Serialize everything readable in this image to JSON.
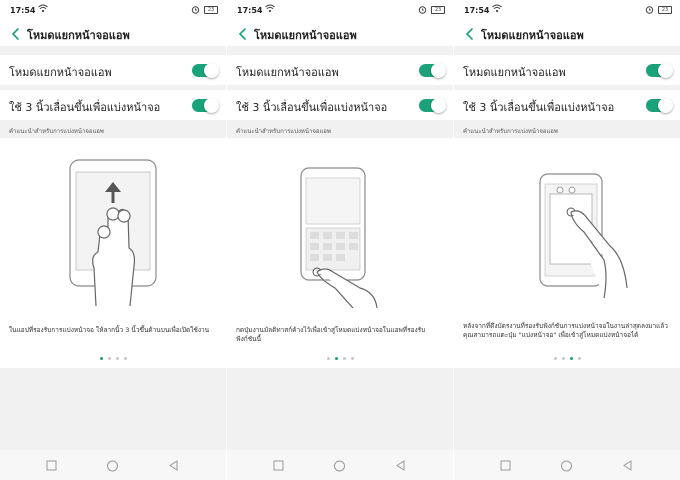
{
  "accent_color": "#1aa37a",
  "panels": [
    {
      "status": {
        "time": "17:54",
        "battery": "23"
      },
      "header": {
        "title": "โหมดแยกหน้าจอแอพ"
      },
      "settings": [
        {
          "label": "โหมดแยกหน้าจอแอพ",
          "toggle_on": true
        },
        {
          "label": "ใช้ 3 นิ้วเลื่อนขึ้นเพื่อแบ่งหน้าจอ",
          "toggle_on": true
        }
      ],
      "section_label": "คำแนะนำสำหรับการแบ่งหน้าจอแอพ",
      "description": "ในแอปที่รองรับการแบ่งหน้าจอ ให้ลากนิ้ว 3 นิ้วขึ้นด้านบนเพื่อเปิดใช้งาน",
      "illustration_icon": "three-finger-swipe-up-icon",
      "page_dots": {
        "count": 4,
        "active": 0
      }
    },
    {
      "status": {
        "time": "17:54",
        "battery": "23"
      },
      "header": {
        "title": "โหมดแยกหน้าจอแอพ"
      },
      "settings": [
        {
          "label": "โหมดแยกหน้าจอแอพ",
          "toggle_on": true
        },
        {
          "label": "ใช้ 3 นิ้วเลื่อนขึ้นเพื่อแบ่งหน้าจอ",
          "toggle_on": true
        }
      ],
      "section_label": "คำแนะนำสำหรับการแบ่งหน้าจอแอพ",
      "description": "กดปุ่มงานมัลติทาสก์ค้างไว้เพื่อเข้าสู่โหมดแบ่งหน้าจอในแอพที่รองรับฟังก์ชันนี้",
      "illustration_icon": "multitask-long-press-icon",
      "page_dots": {
        "count": 4,
        "active": 1
      }
    },
    {
      "status": {
        "time": "17:54",
        "battery": "23"
      },
      "header": {
        "title": "โหมดแยกหน้าจอแอพ"
      },
      "settings": [
        {
          "label": "โหมดแยกหน้าจอแอพ",
          "toggle_on": true
        },
        {
          "label": "ใช้ 3 นิ้วเลื่อนขึ้นเพื่อแบ่งหน้าจอ",
          "toggle_on": true
        }
      ],
      "section_label": "คำแนะนำสำหรับการแบ่งหน้าจอแอพ",
      "description": "หลังจากที่ดึงบัตรงานที่รองรับฟังก์ชันการแบ่งหน้าจอในงานล่าสุดลงมาแล้ว คุณสามารถแตะปุ่ม \"แบ่งหน้าจอ\" เพื่อเข้าสู่โหมดแบ่งหน้าจอได้",
      "illustration_icon": "recent-card-split-icon",
      "page_dots": {
        "count": 4,
        "active": 2
      }
    }
  ]
}
